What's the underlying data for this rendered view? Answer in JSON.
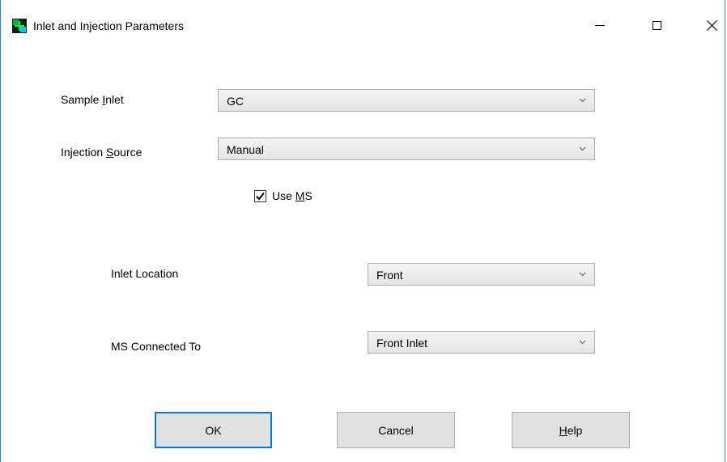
{
  "window": {
    "title": "Inlet and Injection Parameters",
    "icon": "app-icon"
  },
  "titlebar": {
    "minimize_icon": "minimize-icon",
    "maximize_icon": "maximize-icon",
    "close_icon": "close-icon"
  },
  "form": {
    "sample_inlet": {
      "label_pre": "Sample ",
      "label_acc": "I",
      "label_post": "nlet",
      "value": "GC"
    },
    "injection_source": {
      "label_pre": "Injection ",
      "label_acc": "S",
      "label_post": "ource",
      "value": "Manual"
    },
    "use_ms": {
      "label_pre": "Use ",
      "label_acc": "M",
      "label_post": "S",
      "checked": true
    },
    "inlet_location": {
      "label": "Inlet Location",
      "value": "Front"
    },
    "ms_connected_to": {
      "label": "MS Connected To",
      "value": "Front Inlet"
    }
  },
  "buttons": {
    "ok": "OK",
    "cancel": "Cancel",
    "help_acc": "H",
    "help_post": "elp"
  },
  "colors": {
    "accent": "#0078d7",
    "window_border": "#1e88e5"
  }
}
